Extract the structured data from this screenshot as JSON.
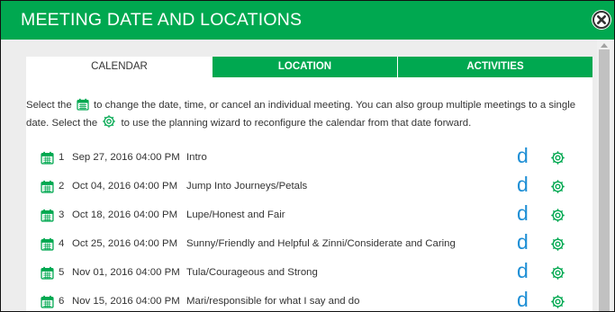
{
  "dialog": {
    "title": "MEETING DATE AND LOCATIONS",
    "close_icon": "close-circle-icon"
  },
  "tabs": [
    {
      "label": "CALENDAR",
      "active": true
    },
    {
      "label": "LOCATION",
      "active": false
    },
    {
      "label": "ACTIVITIES",
      "active": false
    }
  ],
  "instructions": {
    "part1": "Select the",
    "part2": "to change the date, time, or cancel an individual meeting. You can also group multiple meetings to a single date. Select the",
    "part3": "to use the planning wizard to reconfigure the calendar from that date forward."
  },
  "meetings": [
    {
      "number": "1",
      "datetime": "Sep 27, 2016 04:00 PM",
      "name": "Intro",
      "action": "d"
    },
    {
      "number": "2",
      "datetime": "Oct 04, 2016 04:00 PM",
      "name": "Jump Into Journeys/Petals",
      "action": "d"
    },
    {
      "number": "3",
      "datetime": "Oct 18, 2016 04:00 PM",
      "name": "Lupe/Honest and Fair",
      "action": "d"
    },
    {
      "number": "4",
      "datetime": "Oct 25, 2016 04:00 PM",
      "name": "Sunny/Friendly and Helpful & Zinni/Considerate and Caring",
      "action": "d"
    },
    {
      "number": "5",
      "datetime": "Nov 01, 2016 04:00 PM",
      "name": "Tula/Courageous and Strong",
      "action": "d"
    },
    {
      "number": "6",
      "datetime": "Nov 15, 2016 04:00 PM",
      "name": "Mari/responsible for what I say and do",
      "action": "d"
    }
  ],
  "colors": {
    "brand_green": "#00a850",
    "action_blue": "#1e8fd5"
  },
  "icons": {
    "calendar": "calendar-icon",
    "wizard": "gear-icon"
  }
}
